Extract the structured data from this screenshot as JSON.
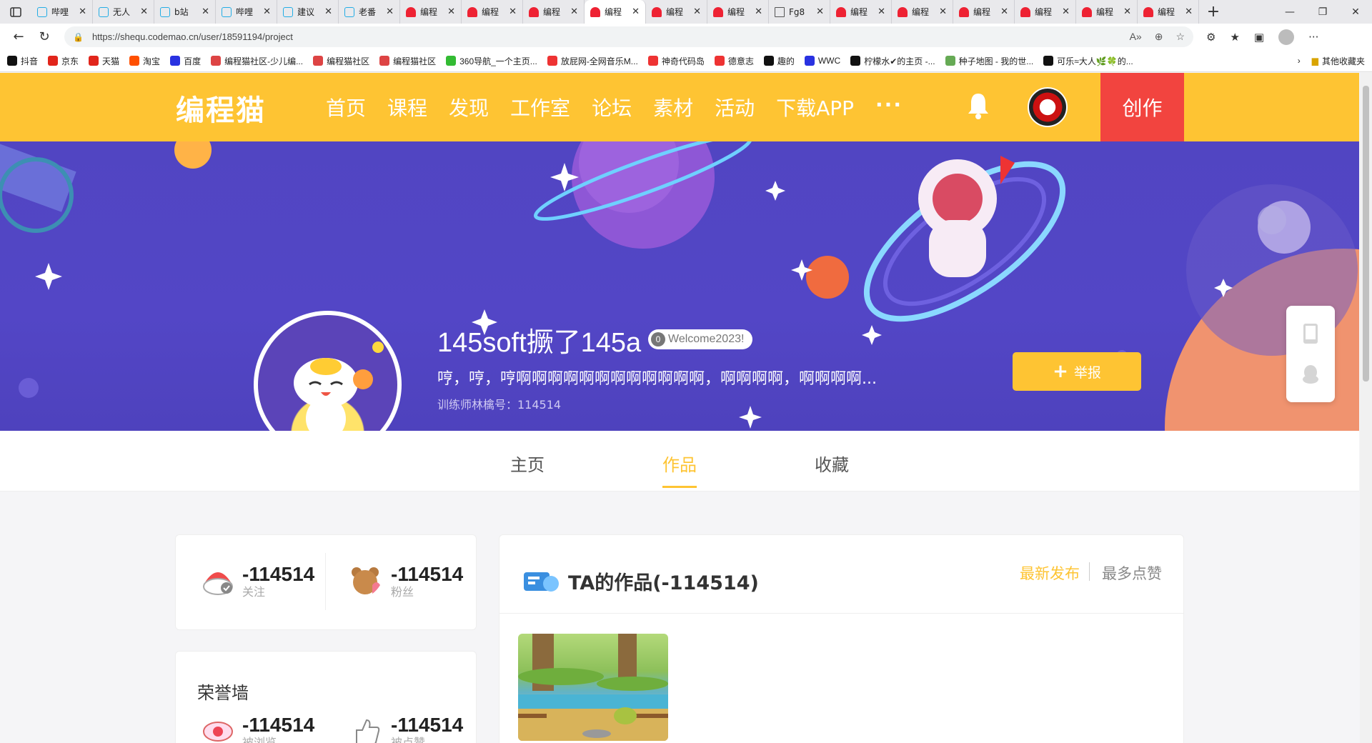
{
  "browser": {
    "tabs": [
      {
        "title": "哔哩",
        "icon": "bilibili-icon"
      },
      {
        "title": "无人",
        "icon": "bilibili-icon"
      },
      {
        "title": "b站",
        "icon": "bilibili-icon"
      },
      {
        "title": "哔哩",
        "icon": "bilibili-icon"
      },
      {
        "title": "建议",
        "icon": "bilibili-icon"
      },
      {
        "title": "老番",
        "icon": "bilibili-icon"
      },
      {
        "title": "编程",
        "icon": "codemao-icon"
      },
      {
        "title": "编程",
        "icon": "codemao-icon"
      },
      {
        "title": "编程",
        "icon": "codemao-icon"
      },
      {
        "title": "编程",
        "icon": "codemao-icon",
        "active": true
      },
      {
        "title": "编程",
        "icon": "codemao-icon"
      },
      {
        "title": "编程",
        "icon": "codemao-icon"
      },
      {
        "title": "Fg8",
        "icon": "file-icon"
      },
      {
        "title": "编程",
        "icon": "codemao-icon"
      },
      {
        "title": "编程",
        "icon": "codemao-icon"
      },
      {
        "title": "编程",
        "icon": "codemao-icon"
      },
      {
        "title": "编程",
        "icon": "codemao-icon"
      },
      {
        "title": "编程",
        "icon": "codemao-icon"
      },
      {
        "title": "编程",
        "icon": "codemao-icon"
      }
    ],
    "url": "https://shequ.codemao.cn/user/18591194/project",
    "bookmarks": [
      {
        "label": "抖音",
        "color": "#111"
      },
      {
        "label": "京东",
        "color": "#e1251b"
      },
      {
        "label": "天猫",
        "color": "#e1251b"
      },
      {
        "label": "淘宝",
        "color": "#ff5000"
      },
      {
        "label": "百度",
        "color": "#2932e1"
      },
      {
        "label": "编程猫社区-少儿编...",
        "color": "#d44"
      },
      {
        "label": "编程猫社区",
        "color": "#d44"
      },
      {
        "label": "编程猫社区",
        "color": "#d44"
      },
      {
        "label": "360导航_一个主页...",
        "color": "#3b3"
      },
      {
        "label": "放屁网-全网音乐M...",
        "color": "#e33"
      },
      {
        "label": "神奇代码岛",
        "color": "#e33"
      },
      {
        "label": "德意志",
        "color": "#e33"
      },
      {
        "label": "趣的",
        "color": "#111"
      },
      {
        "label": "WWC",
        "color": "#2932e1"
      },
      {
        "label": "柠檬水✔的主页 -...",
        "color": "#111"
      },
      {
        "label": "种子地图 - 我的世...",
        "color": "#6a5"
      },
      {
        "label": "可乐≈大人🌿🍀的...",
        "color": "#111"
      }
    ],
    "other_bookmarks": "其他收藏夹"
  },
  "header": {
    "logo": "编程猫",
    "nav": [
      "首页",
      "课程",
      "发现",
      "工作室",
      "论坛",
      "素材",
      "活动",
      "下载APP"
    ],
    "more": "···",
    "create": "创作"
  },
  "profile": {
    "name": "145soft撅了145a",
    "level": "0",
    "badge": "Welcome2023!",
    "description": "哼，哼，哼啊啊啊啊啊啊啊啊啊啊啊啊，啊啊啊啊，啊啊啊啊...",
    "trainer_id": "训练师林檎号：114514",
    "report": "举报"
  },
  "tabs": [
    "主页",
    "作品",
    "收藏"
  ],
  "stats": {
    "following": {
      "value": "-114514",
      "label": "关注"
    },
    "fans": {
      "value": "-114514",
      "label": "粉丝"
    }
  },
  "honor": {
    "title": "荣誉墙",
    "views": {
      "value": "-114514",
      "label": "被浏览"
    },
    "likes": {
      "value": "-114514",
      "label": "被点赞"
    }
  },
  "works": {
    "title": "TA的作品(-114514)",
    "sort_latest": "最新发布",
    "sort_likes": "最多点赞"
  }
}
